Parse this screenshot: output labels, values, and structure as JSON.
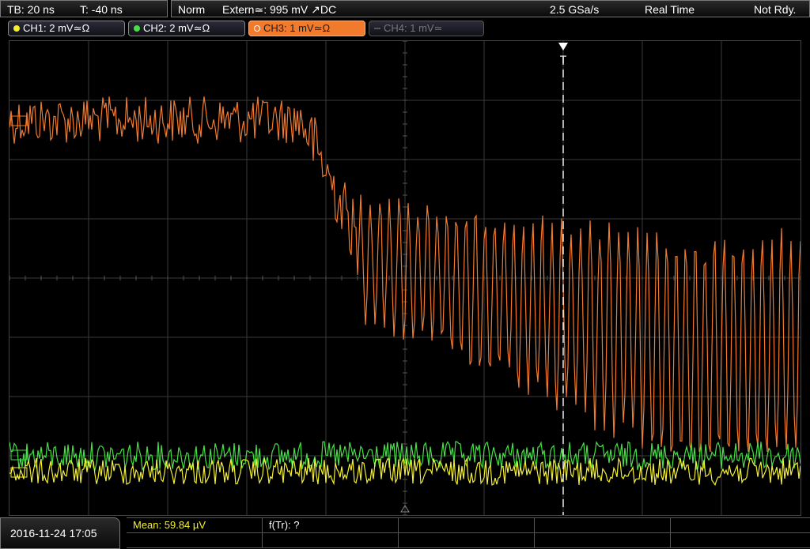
{
  "top": {
    "tb_label": "TB: 20 ns",
    "t_label": "T: -40 ns",
    "mode": "Norm",
    "trigger": "Extern≃: 995 mV ↗DC",
    "sample_rate": "2.5 GSa/s",
    "acq_mode": "Real Time",
    "status": "Not Rdy."
  },
  "channels": [
    {
      "label": "CH1: 2 mV≃Ω",
      "color": "#f4f030",
      "state": "on"
    },
    {
      "label": "CH2: 2 mV≃Ω",
      "color": "#44e044",
      "state": "on"
    },
    {
      "label": "CH3: 1 mV≃Ω",
      "color": "#f27a2c",
      "state": "active"
    },
    {
      "label": "CH4: 1 mV≃",
      "color": "#666666",
      "state": "off"
    }
  ],
  "trigger_marker": "T",
  "bottom": {
    "datetime": "2016-11-24 17:05",
    "mean": "Mean: 59.84 µV",
    "f_tr": "f(Tr): ?"
  },
  "colors": {
    "grid": "#3a3a3a",
    "ch1": "#f4f030",
    "ch2": "#44e044",
    "ch3": "#f27a2c"
  }
}
